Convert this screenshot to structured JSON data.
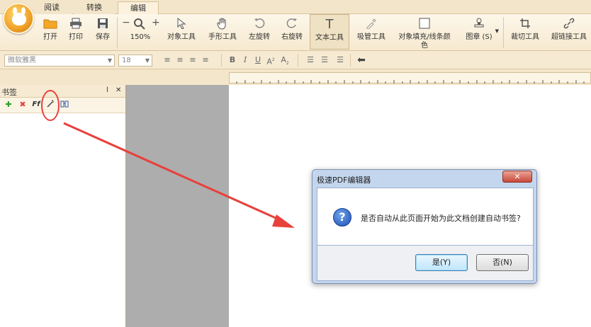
{
  "tabs": [
    {
      "label": "阅读",
      "active": false
    },
    {
      "label": "转换",
      "active": false
    },
    {
      "label": "编辑",
      "active": true
    }
  ],
  "toolbar": {
    "open_label": "打开",
    "print_label": "打印",
    "save_label": "保存",
    "zoom_out_symbol": "−",
    "zoom_in_symbol": "+",
    "zoom_level": "150%",
    "object_tool_label": "对象工具",
    "hand_tool_label": "手形工具",
    "rotate_left_label": "左旋转",
    "rotate_right_label": "右旋转",
    "text_tool_label": "文本工具",
    "eyedropper_label": "吸管工具",
    "fill_label_line1": "对象填充/线条颜",
    "fill_label_line2": "色",
    "stamp_label": "图章 (S)",
    "crop_label": "裁切工具",
    "link_label": "超链接工具"
  },
  "format": {
    "font_name": "微软雅黑",
    "font_size": "18",
    "bold": "B",
    "italic": "I",
    "underline": "U",
    "superscript": "A",
    "subscript": "A"
  },
  "bookmark_panel": {
    "title": "书签",
    "pin_symbol": "ⅼ",
    "close_symbol": "✕"
  },
  "dialog": {
    "title": "极速PDF编辑器",
    "close_symbol": "✕",
    "icon_symbol": "?",
    "message": "是否自动从此页面开始为此文档创建自动书签?",
    "yes_label": "是(Y)",
    "no_label": "否(N)"
  },
  "colors": {
    "accent_tab": "#fbf1dc",
    "annotation_red": "#e8413c",
    "dialog_frame": "#c4d6ee"
  }
}
